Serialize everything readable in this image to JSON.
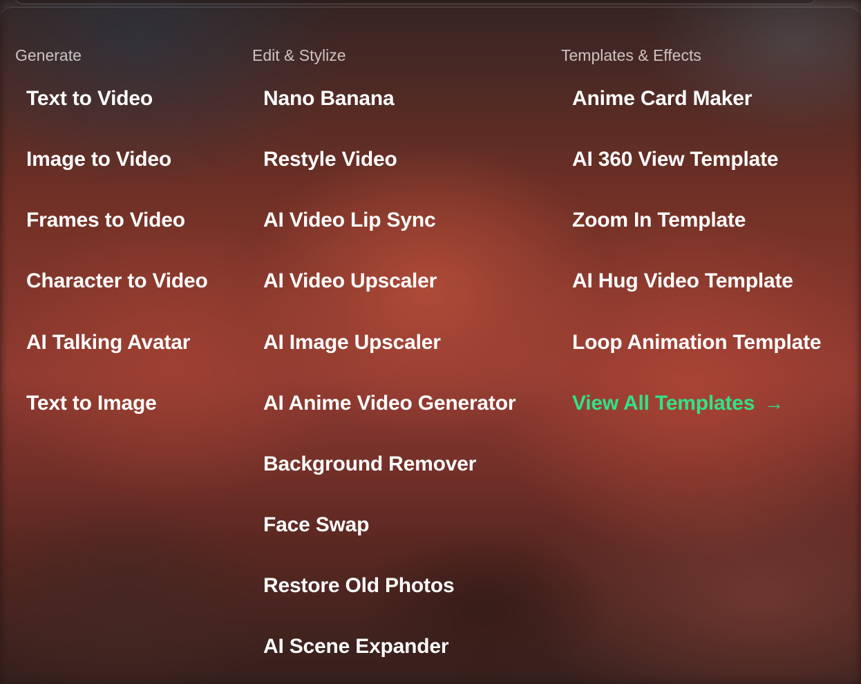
{
  "columns": [
    {
      "heading": "Generate",
      "items": [
        "Text to Video",
        "Image to Video",
        "Frames to Video",
        "Character to Video",
        "AI Talking Avatar",
        "Text to Image"
      ]
    },
    {
      "heading": "Edit & Stylize",
      "items": [
        "Nano Banana",
        "Restyle Video",
        "AI Video Lip Sync",
        "AI Video Upscaler",
        "AI Image Upscaler",
        "AI Anime Video Generator",
        "Background Remover",
        "Face Swap",
        "Restore Old Photos",
        "AI Scene Expander"
      ]
    },
    {
      "heading": "Templates & Effects",
      "items": [
        "Anime Card Maker",
        "AI 360 View Template",
        "Zoom In Template",
        "AI Hug Video Template",
        "Loop Animation Template"
      ],
      "view_all": {
        "label": "View All Templates",
        "icon": "arrow-right-icon",
        "color": "#2fe38a"
      }
    }
  ]
}
